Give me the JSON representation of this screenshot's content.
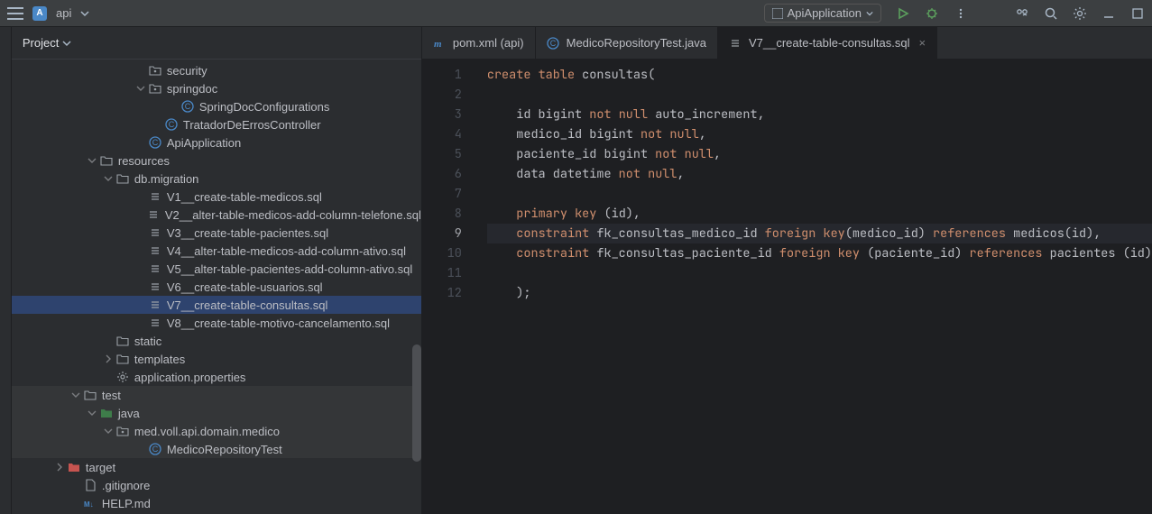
{
  "topbar": {
    "project_badge": "A",
    "project_name": "api",
    "run_config": "ApiApplication"
  },
  "panel": {
    "title": "Project"
  },
  "tree": [
    {
      "indent": 7,
      "chev": "",
      "icon": "folder-dot",
      "label": "security"
    },
    {
      "indent": 7,
      "chev": "down",
      "icon": "folder-dot",
      "label": "springdoc"
    },
    {
      "indent": 9,
      "chev": "",
      "icon": "class",
      "label": "SpringDocConfigurations"
    },
    {
      "indent": 8,
      "chev": "",
      "icon": "class",
      "label": "TratadorDeErrosController"
    },
    {
      "indent": 7,
      "chev": "",
      "icon": "class",
      "label": "ApiApplication"
    },
    {
      "indent": 4,
      "chev": "down",
      "icon": "folder",
      "label": "resources"
    },
    {
      "indent": 5,
      "chev": "down",
      "icon": "folder",
      "label": "db.migration"
    },
    {
      "indent": 7,
      "chev": "",
      "icon": "sql",
      "label": "V1__create-table-medicos.sql"
    },
    {
      "indent": 7,
      "chev": "",
      "icon": "sql",
      "label": "V2__alter-table-medicos-add-column-telefone.sql"
    },
    {
      "indent": 7,
      "chev": "",
      "icon": "sql",
      "label": "V3__create-table-pacientes.sql"
    },
    {
      "indent": 7,
      "chev": "",
      "icon": "sql",
      "label": "V4__alter-table-medicos-add-column-ativo.sql"
    },
    {
      "indent": 7,
      "chev": "",
      "icon": "sql",
      "label": "V5__alter-table-pacientes-add-column-ativo.sql"
    },
    {
      "indent": 7,
      "chev": "",
      "icon": "sql",
      "label": "V6__create-table-usuarios.sql"
    },
    {
      "indent": 7,
      "chev": "",
      "icon": "sql",
      "label": "V7__create-table-consultas.sql",
      "selected": true
    },
    {
      "indent": 7,
      "chev": "",
      "icon": "sql",
      "label": "V8__create-table-motivo-cancelamento.sql"
    },
    {
      "indent": 5,
      "chev": "",
      "icon": "folder",
      "label": "static"
    },
    {
      "indent": 5,
      "chev": "right",
      "icon": "folder",
      "label": "templates"
    },
    {
      "indent": 5,
      "chev": "",
      "icon": "gear",
      "label": "application.properties"
    },
    {
      "indent": 3,
      "chev": "down",
      "icon": "folder",
      "label": "test",
      "hl": true
    },
    {
      "indent": 4,
      "chev": "down",
      "icon": "folder-src",
      "label": "java",
      "hl": true
    },
    {
      "indent": 5,
      "chev": "down",
      "icon": "package",
      "label": "med.voll.api.domain.medico",
      "hl": true
    },
    {
      "indent": 7,
      "chev": "",
      "icon": "class",
      "label": "MedicoRepositoryTest",
      "hl": true
    },
    {
      "indent": 2,
      "chev": "right",
      "icon": "folder-target",
      "label": "target"
    },
    {
      "indent": 3,
      "chev": "",
      "icon": "file",
      "label": ".gitignore"
    },
    {
      "indent": 3,
      "chev": "",
      "icon": "md",
      "label": "HELP.md"
    }
  ],
  "tabs": [
    {
      "icon": "maven",
      "label": "pom.xml (api)",
      "active": false,
      "closable": false
    },
    {
      "icon": "class",
      "label": "MedicoRepositoryTest.java",
      "active": false,
      "closable": false
    },
    {
      "icon": "sql",
      "label": "V7__create-table-consultas.sql",
      "active": true,
      "closable": true
    }
  ],
  "code": {
    "current_line": 9,
    "lines": [
      {
        "n": 1,
        "html": "<span class='kw'>create</span> <span class='kw'>table</span> consultas("
      },
      {
        "n": 2,
        "html": ""
      },
      {
        "n": 3,
        "html": "    id bigint <span class='kw'>not</span> <span class='kw'>null</span> auto_increment,"
      },
      {
        "n": 4,
        "html": "    medico_id bigint <span class='kw'>not</span> <span class='kw'>null</span>,"
      },
      {
        "n": 5,
        "html": "    paciente_id bigint <span class='kw'>not</span> <span class='kw'>null</span>,"
      },
      {
        "n": 6,
        "html": "    data datetime <span class='kw'>not</span> <span class='kw'>null</span>,"
      },
      {
        "n": 7,
        "html": ""
      },
      {
        "n": 8,
        "html": "    <span class='kw'>primary</span> <span class='kw'>key</span> (id),"
      },
      {
        "n": 9,
        "html": "    <span class='kw'>constraint</span> fk_consultas_medico_id <span class='kw'>foreign</span> <span class='kw'>key</span>(medico_id) <span class='kw'>references</span> medicos(id),"
      },
      {
        "n": 10,
        "html": "    <span class='kw'>constraint</span> fk_consultas_paciente_id <span class='kw'>foreign</span> <span class='kw'>key</span> (paciente_id) <span class='kw'>references</span> pacientes (id)"
      },
      {
        "n": 11,
        "html": ""
      },
      {
        "n": 12,
        "html": "    );"
      }
    ]
  }
}
